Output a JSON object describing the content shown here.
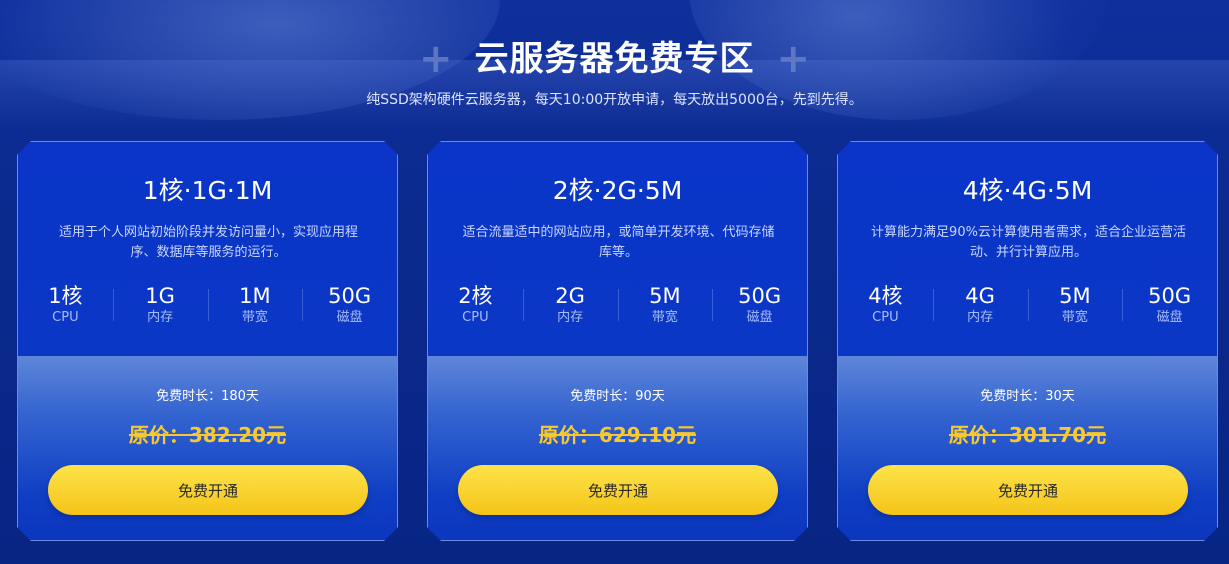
{
  "header": {
    "plus_left": "+",
    "title": "云服务器免费专区",
    "plus_right": "+",
    "subtitle": "纯SSD架构硬件云服务器，每天10:00开放申请，每天放出5000台，先到先得。"
  },
  "colors": {
    "background": "#0a2a8e",
    "card_top": "#0b37c6",
    "button": "#f5c419",
    "price": "#f8c92e"
  },
  "cards": [
    {
      "name": "1核·1G·1M",
      "description": "适用于个人网站初始阶段并发访问量小，实现应用程序、数据库等服务的运行。",
      "specs": [
        {
          "value": "1核",
          "label": "CPU"
        },
        {
          "value": "1G",
          "label": "内存"
        },
        {
          "value": "1M",
          "label": "带宽"
        },
        {
          "value": "50G",
          "label": "磁盘"
        }
      ],
      "free_duration": "免费时长：180天",
      "original_price": "原价：382.20元",
      "button_label": "免费开通"
    },
    {
      "name": "2核·2G·5M",
      "description": "适合流量适中的网站应用，或简单开发环境、代码存储库等。",
      "specs": [
        {
          "value": "2核",
          "label": "CPU"
        },
        {
          "value": "2G",
          "label": "内存"
        },
        {
          "value": "5M",
          "label": "带宽"
        },
        {
          "value": "50G",
          "label": "磁盘"
        }
      ],
      "free_duration": "免费时长：90天",
      "original_price": "原价：629.10元",
      "button_label": "免费开通"
    },
    {
      "name": "4核·4G·5M",
      "description": "计算能力满足90%云计算使用者需求，适合企业运营活动、并行计算应用。",
      "specs": [
        {
          "value": "4核",
          "label": "CPU"
        },
        {
          "value": "4G",
          "label": "内存"
        },
        {
          "value": "5M",
          "label": "带宽"
        },
        {
          "value": "50G",
          "label": "磁盘"
        }
      ],
      "free_duration": "免费时长：30天",
      "original_price": "原价：301.70元",
      "button_label": "免费开通"
    }
  ]
}
